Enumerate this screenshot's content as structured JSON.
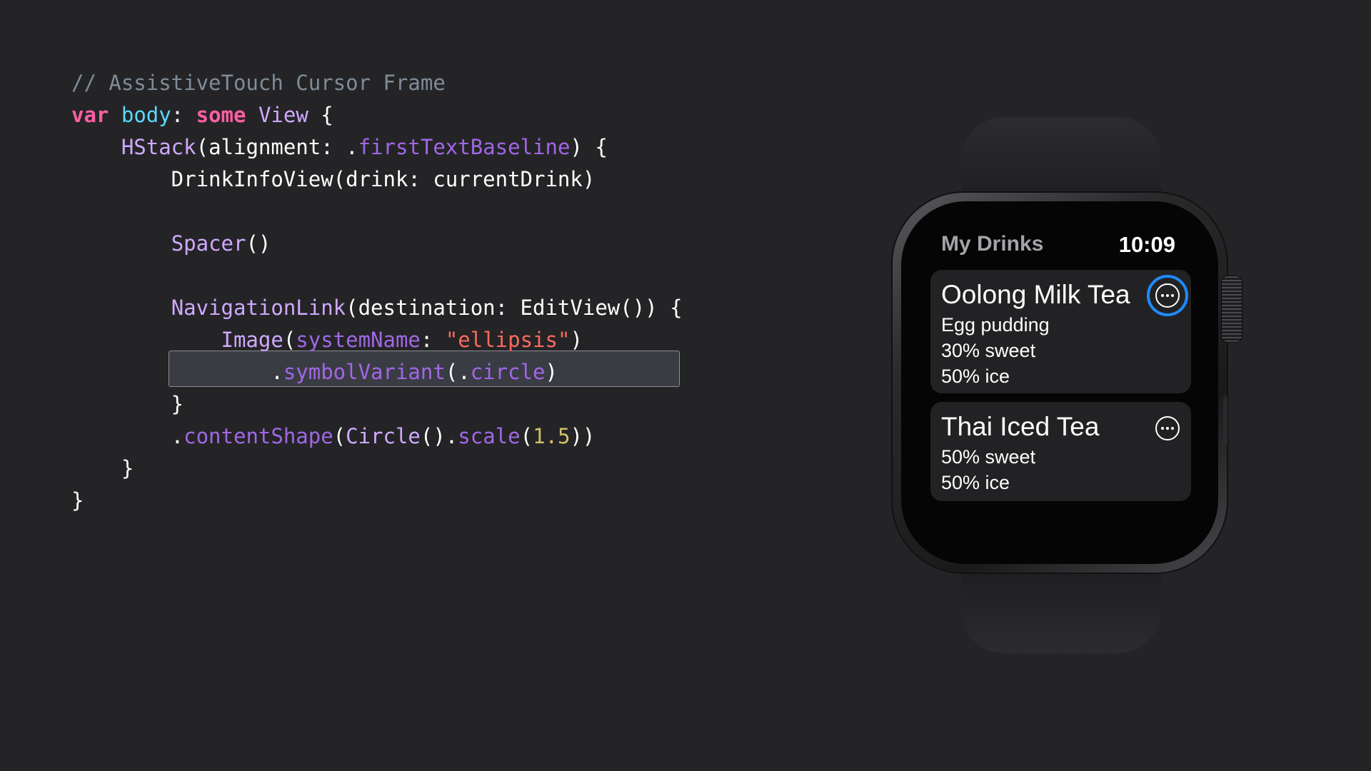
{
  "code": {
    "lines": [
      [
        {
          "text": "// AssistiveTouch Cursor Frame",
          "cls": "t-comment"
        }
      ],
      [
        {
          "text": "var",
          "cls": "t-kw"
        },
        {
          "text": " ",
          "cls": "t-plain"
        },
        {
          "text": "body",
          "cls": "t-decl"
        },
        {
          "text": ": ",
          "cls": "t-plain"
        },
        {
          "text": "some",
          "cls": "t-kw"
        },
        {
          "text": " ",
          "cls": "t-plain"
        },
        {
          "text": "View",
          "cls": "t-type"
        },
        {
          "text": " {",
          "cls": "t-plain"
        }
      ],
      [
        {
          "text": "    ",
          "cls": "t-plain"
        },
        {
          "text": "HStack",
          "cls": "t-type"
        },
        {
          "text": "(alignment: .",
          "cls": "t-plain"
        },
        {
          "text": "firstTextBaseline",
          "cls": "t-member"
        },
        {
          "text": ") {",
          "cls": "t-plain"
        }
      ],
      [
        {
          "text": "        DrinkInfoView(drink: currentDrink)",
          "cls": "t-plain"
        }
      ],
      [
        {
          "text": "",
          "cls": "t-plain"
        }
      ],
      [
        {
          "text": "        ",
          "cls": "t-plain"
        },
        {
          "text": "Spacer",
          "cls": "t-type"
        },
        {
          "text": "()",
          "cls": "t-plain"
        }
      ],
      [
        {
          "text": "",
          "cls": "t-plain"
        }
      ],
      [
        {
          "text": "        ",
          "cls": "t-plain"
        },
        {
          "text": "NavigationLink",
          "cls": "t-type"
        },
        {
          "text": "(destination: EditView()) {",
          "cls": "t-plain"
        }
      ],
      [
        {
          "text": "            ",
          "cls": "t-plain"
        },
        {
          "text": "Image",
          "cls": "t-type"
        },
        {
          "text": "(",
          "cls": "t-plain"
        },
        {
          "text": "systemName",
          "cls": "t-member"
        },
        {
          "text": ": ",
          "cls": "t-plain"
        },
        {
          "text": "\"ellipsis\"",
          "cls": "t-str"
        },
        {
          "text": ")",
          "cls": "t-plain"
        }
      ],
      [
        {
          "text": "                .",
          "cls": "t-plain"
        },
        {
          "text": "symbolVariant",
          "cls": "t-member"
        },
        {
          "text": "(.",
          "cls": "t-plain"
        },
        {
          "text": "circle",
          "cls": "t-member"
        },
        {
          "text": ")",
          "cls": "t-plain"
        }
      ],
      [
        {
          "text": "        }",
          "cls": "t-plain"
        }
      ],
      [
        {
          "text": "        .",
          "cls": "t-plain"
        },
        {
          "text": "contentShape",
          "cls": "t-member"
        },
        {
          "text": "(",
          "cls": "t-plain"
        },
        {
          "text": "Circle",
          "cls": "t-type"
        },
        {
          "text": "().",
          "cls": "t-plain"
        },
        {
          "text": "scale",
          "cls": "t-member"
        },
        {
          "text": "(",
          "cls": "t-plain"
        },
        {
          "text": "1.5",
          "cls": "t-num"
        },
        {
          "text": "))",
          "cls": "t-plain"
        }
      ],
      [
        {
          "text": "    }",
          "cls": "t-plain"
        }
      ],
      [
        {
          "text": "}",
          "cls": "t-plain"
        }
      ]
    ],
    "highlighted_line_index": 11
  },
  "watch": {
    "title": "My Drinks",
    "time": "10:09",
    "drinks": [
      {
        "name": "Oolong Milk Tea",
        "details": [
          "Egg pudding",
          "30% sweet",
          "50% ice"
        ],
        "cursor_focused": true,
        "action_icon": "ellipsis-circle-icon"
      },
      {
        "name": "Thai Iced Tea",
        "details": [
          "50% sweet",
          "50% ice"
        ],
        "cursor_focused": false,
        "action_icon": "ellipsis-circle-icon"
      }
    ]
  },
  "colors": {
    "background": "#242426",
    "cursor": "#1e8bff",
    "comment": "#7f8c98",
    "keyword": "#fc5fa3",
    "declaration": "#5dd8ff",
    "type": "#d0a8ff",
    "member": "#a167e6",
    "string": "#fc6a5d",
    "number": "#d0bf69"
  }
}
